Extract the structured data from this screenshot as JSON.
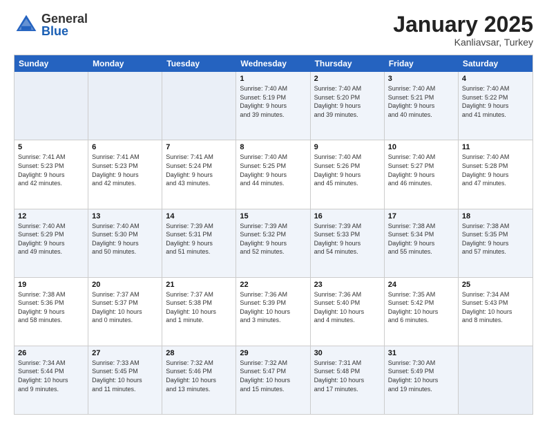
{
  "header": {
    "logo_general": "General",
    "logo_blue": "Blue",
    "month": "January 2025",
    "location": "Kanliavsar, Turkey"
  },
  "days_of_week": [
    "Sunday",
    "Monday",
    "Tuesday",
    "Wednesday",
    "Thursday",
    "Friday",
    "Saturday"
  ],
  "rows": [
    [
      {
        "day": "",
        "info": ""
      },
      {
        "day": "",
        "info": ""
      },
      {
        "day": "",
        "info": ""
      },
      {
        "day": "1",
        "info": "Sunrise: 7:40 AM\nSunset: 5:19 PM\nDaylight: 9 hours\nand 39 minutes."
      },
      {
        "day": "2",
        "info": "Sunrise: 7:40 AM\nSunset: 5:20 PM\nDaylight: 9 hours\nand 39 minutes."
      },
      {
        "day": "3",
        "info": "Sunrise: 7:40 AM\nSunset: 5:21 PM\nDaylight: 9 hours\nand 40 minutes."
      },
      {
        "day": "4",
        "info": "Sunrise: 7:40 AM\nSunset: 5:22 PM\nDaylight: 9 hours\nand 41 minutes."
      }
    ],
    [
      {
        "day": "5",
        "info": "Sunrise: 7:41 AM\nSunset: 5:23 PM\nDaylight: 9 hours\nand 42 minutes."
      },
      {
        "day": "6",
        "info": "Sunrise: 7:41 AM\nSunset: 5:23 PM\nDaylight: 9 hours\nand 42 minutes."
      },
      {
        "day": "7",
        "info": "Sunrise: 7:41 AM\nSunset: 5:24 PM\nDaylight: 9 hours\nand 43 minutes."
      },
      {
        "day": "8",
        "info": "Sunrise: 7:40 AM\nSunset: 5:25 PM\nDaylight: 9 hours\nand 44 minutes."
      },
      {
        "day": "9",
        "info": "Sunrise: 7:40 AM\nSunset: 5:26 PM\nDaylight: 9 hours\nand 45 minutes."
      },
      {
        "day": "10",
        "info": "Sunrise: 7:40 AM\nSunset: 5:27 PM\nDaylight: 9 hours\nand 46 minutes."
      },
      {
        "day": "11",
        "info": "Sunrise: 7:40 AM\nSunset: 5:28 PM\nDaylight: 9 hours\nand 47 minutes."
      }
    ],
    [
      {
        "day": "12",
        "info": "Sunrise: 7:40 AM\nSunset: 5:29 PM\nDaylight: 9 hours\nand 49 minutes."
      },
      {
        "day": "13",
        "info": "Sunrise: 7:40 AM\nSunset: 5:30 PM\nDaylight: 9 hours\nand 50 minutes."
      },
      {
        "day": "14",
        "info": "Sunrise: 7:39 AM\nSunset: 5:31 PM\nDaylight: 9 hours\nand 51 minutes."
      },
      {
        "day": "15",
        "info": "Sunrise: 7:39 AM\nSunset: 5:32 PM\nDaylight: 9 hours\nand 52 minutes."
      },
      {
        "day": "16",
        "info": "Sunrise: 7:39 AM\nSunset: 5:33 PM\nDaylight: 9 hours\nand 54 minutes."
      },
      {
        "day": "17",
        "info": "Sunrise: 7:38 AM\nSunset: 5:34 PM\nDaylight: 9 hours\nand 55 minutes."
      },
      {
        "day": "18",
        "info": "Sunrise: 7:38 AM\nSunset: 5:35 PM\nDaylight: 9 hours\nand 57 minutes."
      }
    ],
    [
      {
        "day": "19",
        "info": "Sunrise: 7:38 AM\nSunset: 5:36 PM\nDaylight: 9 hours\nand 58 minutes."
      },
      {
        "day": "20",
        "info": "Sunrise: 7:37 AM\nSunset: 5:37 PM\nDaylight: 10 hours\nand 0 minutes."
      },
      {
        "day": "21",
        "info": "Sunrise: 7:37 AM\nSunset: 5:38 PM\nDaylight: 10 hours\nand 1 minute."
      },
      {
        "day": "22",
        "info": "Sunrise: 7:36 AM\nSunset: 5:39 PM\nDaylight: 10 hours\nand 3 minutes."
      },
      {
        "day": "23",
        "info": "Sunrise: 7:36 AM\nSunset: 5:40 PM\nDaylight: 10 hours\nand 4 minutes."
      },
      {
        "day": "24",
        "info": "Sunrise: 7:35 AM\nSunset: 5:42 PM\nDaylight: 10 hours\nand 6 minutes."
      },
      {
        "day": "25",
        "info": "Sunrise: 7:34 AM\nSunset: 5:43 PM\nDaylight: 10 hours\nand 8 minutes."
      }
    ],
    [
      {
        "day": "26",
        "info": "Sunrise: 7:34 AM\nSunset: 5:44 PM\nDaylight: 10 hours\nand 9 minutes."
      },
      {
        "day": "27",
        "info": "Sunrise: 7:33 AM\nSunset: 5:45 PM\nDaylight: 10 hours\nand 11 minutes."
      },
      {
        "day": "28",
        "info": "Sunrise: 7:32 AM\nSunset: 5:46 PM\nDaylight: 10 hours\nand 13 minutes."
      },
      {
        "day": "29",
        "info": "Sunrise: 7:32 AM\nSunset: 5:47 PM\nDaylight: 10 hours\nand 15 minutes."
      },
      {
        "day": "30",
        "info": "Sunrise: 7:31 AM\nSunset: 5:48 PM\nDaylight: 10 hours\nand 17 minutes."
      },
      {
        "day": "31",
        "info": "Sunrise: 7:30 AM\nSunset: 5:49 PM\nDaylight: 10 hours\nand 19 minutes."
      },
      {
        "day": "",
        "info": ""
      }
    ]
  ],
  "alt_rows": [
    0,
    2,
    4
  ]
}
